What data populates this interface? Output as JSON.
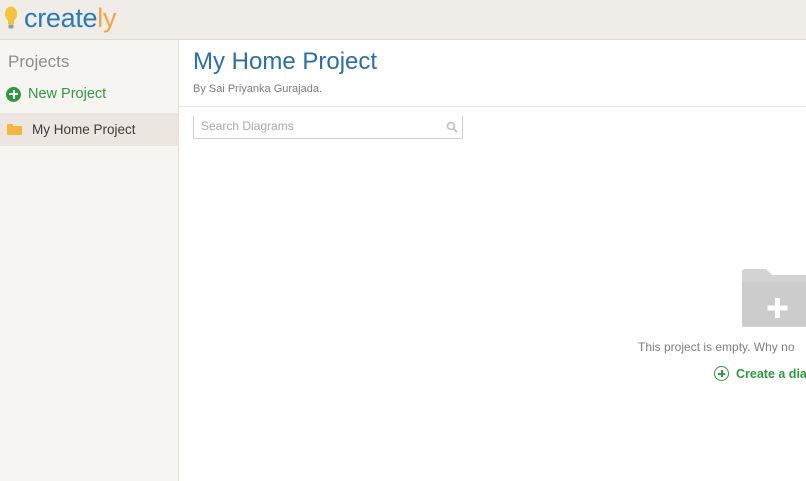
{
  "brand": {
    "logo_main": "create",
    "logo_accent": "ly",
    "colors": {
      "primary": "#2a7ab8",
      "accent": "#f0a63c",
      "green": "#2e9a3e"
    }
  },
  "sidebar": {
    "title": "Projects",
    "new_project_label": "New Project",
    "projects": [
      {
        "label": "My Home Project",
        "icon": "folder-icon",
        "selected": true
      }
    ]
  },
  "main": {
    "title": "My Home Project",
    "byline": "By Sai Priyanka Gurajada.",
    "search": {
      "placeholder": "Search Diagrams",
      "value": ""
    },
    "empty_state": {
      "icon": "add-folder-icon",
      "message": "This project is empty. Why no",
      "create_label": "Create a dia"
    }
  }
}
